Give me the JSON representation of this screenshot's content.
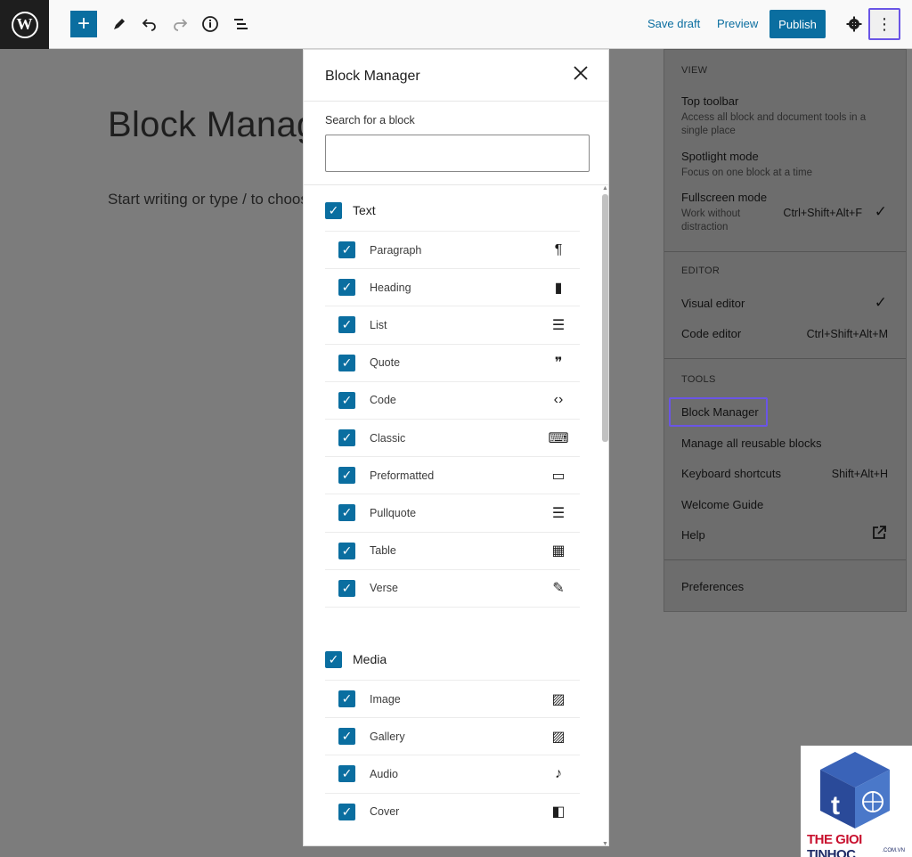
{
  "toolbar": {
    "save_draft": "Save draft",
    "preview": "Preview",
    "publish": "Publish",
    "add_label": "+"
  },
  "editor": {
    "title": "Block Manag",
    "hint": "Start writing or type / to choos"
  },
  "options_menu": {
    "view_heading": "VIEW",
    "top_toolbar": "Top toolbar",
    "top_toolbar_desc": "Access all block and document tools in a single place",
    "spotlight": "Spotlight mode",
    "spotlight_desc": "Focus on one block at a time",
    "fullscreen": "Fullscreen mode",
    "fullscreen_desc": "Work without distraction",
    "fullscreen_shortcut": "Ctrl+Shift+Alt+F",
    "editor_heading": "EDITOR",
    "visual_editor": "Visual editor",
    "code_editor": "Code editor",
    "code_editor_shortcut": "Ctrl+Shift+Alt+M",
    "tools_heading": "TOOLS",
    "block_manager": "Block Manager",
    "manage_reusable": "Manage all reusable blocks",
    "keyboard_shortcuts": "Keyboard shortcuts",
    "keyboard_shortcuts_shortcut": "Shift+Alt+H",
    "welcome_guide": "Welcome Guide",
    "help": "Help",
    "preferences": "Preferences"
  },
  "modal": {
    "title": "Block Manager",
    "search_label": "Search for a block",
    "search_value": "",
    "categories": [
      {
        "title": "Text",
        "blocks": [
          {
            "label": "Paragraph",
            "icon": "¶"
          },
          {
            "label": "Heading",
            "icon": "▮"
          },
          {
            "label": "List",
            "icon": "☰"
          },
          {
            "label": "Quote",
            "icon": "❞"
          },
          {
            "label": "Code",
            "icon": "‹›"
          },
          {
            "label": "Classic",
            "icon": "⌨"
          },
          {
            "label": "Preformatted",
            "icon": "▭"
          },
          {
            "label": "Pullquote",
            "icon": "☰"
          },
          {
            "label": "Table",
            "icon": "▦"
          },
          {
            "label": "Verse",
            "icon": "✎"
          }
        ]
      },
      {
        "title": "Media",
        "blocks": [
          {
            "label": "Image",
            "icon": "▨"
          },
          {
            "label": "Gallery",
            "icon": "▨"
          },
          {
            "label": "Audio",
            "icon": "♪"
          },
          {
            "label": "Cover",
            "icon": "◧"
          }
        ]
      }
    ]
  },
  "watermark": {
    "brand_red": "THE GIOI",
    "brand_dark": "TINHOC",
    "domain": ".COM.VN"
  },
  "colors": {
    "accent": "#0a6ea0",
    "highlight": "#6a55e6",
    "overlay": "#7c7c7c"
  }
}
